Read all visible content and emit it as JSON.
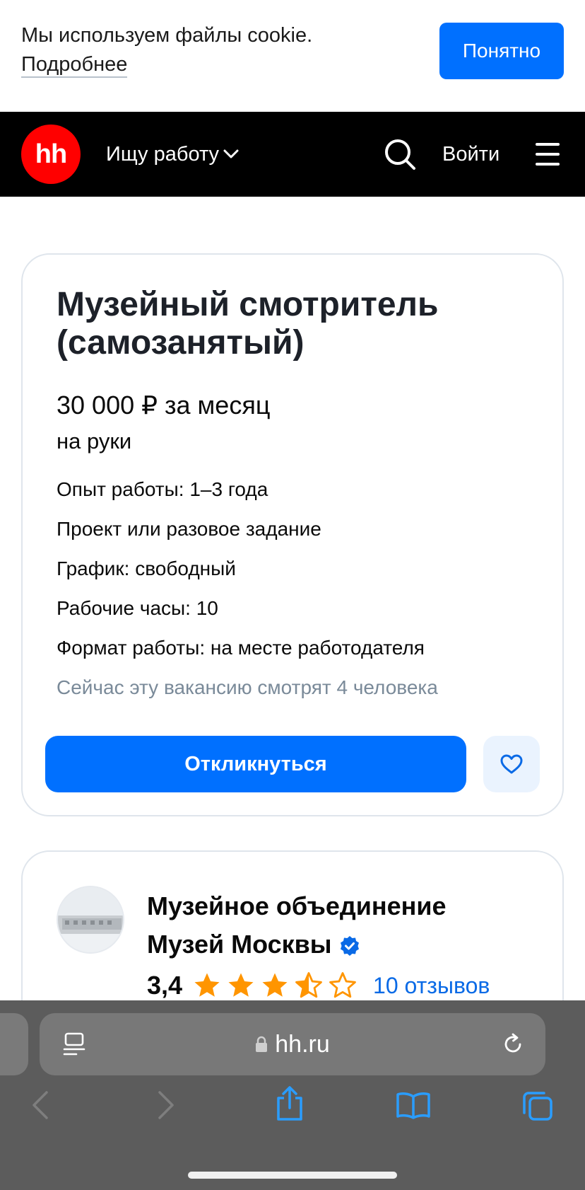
{
  "cookie": {
    "text": "Мы используем файлы cookie.",
    "more_link": "Подробнее",
    "accept_button": "Понятно"
  },
  "header": {
    "logo": "hh",
    "role_select": "Ищу работу",
    "login": "Войти",
    "icons": [
      "search-icon",
      "menu-icon",
      "chevron-down-icon"
    ]
  },
  "vacancy": {
    "title": "Музейный смотритель (самозанятый)",
    "salary": "30 000 ₽ за месяц",
    "salary_note": "на руки",
    "details": [
      "Опыт работы: 1–3 года",
      "Проект или разовое задание",
      "График: свободный",
      "Рабочие часы: 10",
      "Формат работы: на месте работодателя"
    ],
    "watching": "Сейчас эту вакансию смотрят 4 человека",
    "apply_button": "Откликнуться"
  },
  "employer": {
    "name": "Музейное объединение Музей Москвы",
    "rating": "3,4",
    "stars": 3.5,
    "reviews": "10 отзывов"
  },
  "browser": {
    "url": "hh.ru"
  },
  "colors": {
    "accent": "#0070ff",
    "brand_red": "#ff0000",
    "star": "#ff9500",
    "link": "#0a6ae6",
    "muted": "#7a8a99"
  }
}
